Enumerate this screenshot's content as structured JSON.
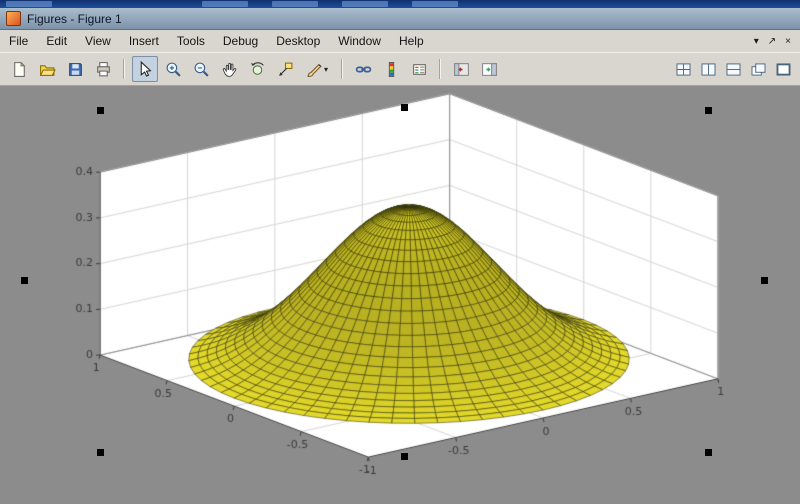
{
  "window": {
    "title": "Figures - Figure 1"
  },
  "menu": {
    "items": [
      "File",
      "Edit",
      "View",
      "Insert",
      "Tools",
      "Debug",
      "Desktop",
      "Window",
      "Help"
    ]
  },
  "figure_controls": {
    "minimize": "▾",
    "undock": "↗",
    "close": "×"
  },
  "toolbar": {
    "active": "edit-plot",
    "dropdown_glyph": "▾",
    "buttons": [
      "new-figure",
      "open-file",
      "save-figure",
      "print-figure",
      "|",
      "edit-plot",
      "zoom-in",
      "zoom-out",
      "pan",
      "rotate-3d",
      "data-cursor",
      "brush-data",
      "|",
      "link-plots",
      "insert-colorbar",
      "insert-legend",
      "|",
      "hide-plot-tools",
      "show-plot-tools-dock"
    ],
    "layout_buttons": [
      "tile-all",
      "tile-left-right",
      "tile-top-bottom",
      "float-windows",
      "maximize-figure"
    ]
  },
  "colors": {
    "titlebar": "#8aa0b8",
    "toolbar_bg": "#d9d6cf",
    "figure_background": "#8c8c8c",
    "selection_handles": "#000000"
  },
  "chart_data": {
    "type": "surface",
    "title": "",
    "xlabel": "",
    "ylabel": "",
    "zlabel": "",
    "view": {
      "azimuth": -37.5,
      "elevation": 30
    },
    "x_range": [
      -1,
      1
    ],
    "y_range": [
      -1,
      1
    ],
    "z_range": [
      0,
      0.4
    ],
    "x_ticks": [
      -1,
      -0.5,
      0,
      0.5,
      1
    ],
    "x_tick_labels": [
      "-1",
      "-0.5",
      "0",
      "0.5",
      "1"
    ],
    "y_ticks": [
      -1,
      -0.5,
      0,
      0.5,
      1
    ],
    "y_tick_labels": [
      "-1",
      "-0.5",
      "0",
      "0.5",
      "1"
    ],
    "z_ticks": [
      0,
      0.1,
      0.2,
      0.3,
      0.4
    ],
    "z_tick_labels": [
      "0",
      "0.1",
      "0.2",
      "0.3",
      "0.4"
    ],
    "grid": true,
    "box": true,
    "wall_color": "#ffffff",
    "grid_color": "#d6d6d6",
    "box_color": "#8f8f8f",
    "axis_color": "#3c3c3c",
    "background": "#8c8c8c",
    "surface": {
      "coordinates": "polar",
      "formula": "z = 0.35 * exp(-3 * r^2)",
      "amplitude": 0.35,
      "decay": 3,
      "radius": 1,
      "rings": 24,
      "sectors": 60,
      "peak_z": 0.35,
      "face_color": "#e9df2a",
      "edge_color": "#32320a"
    }
  }
}
